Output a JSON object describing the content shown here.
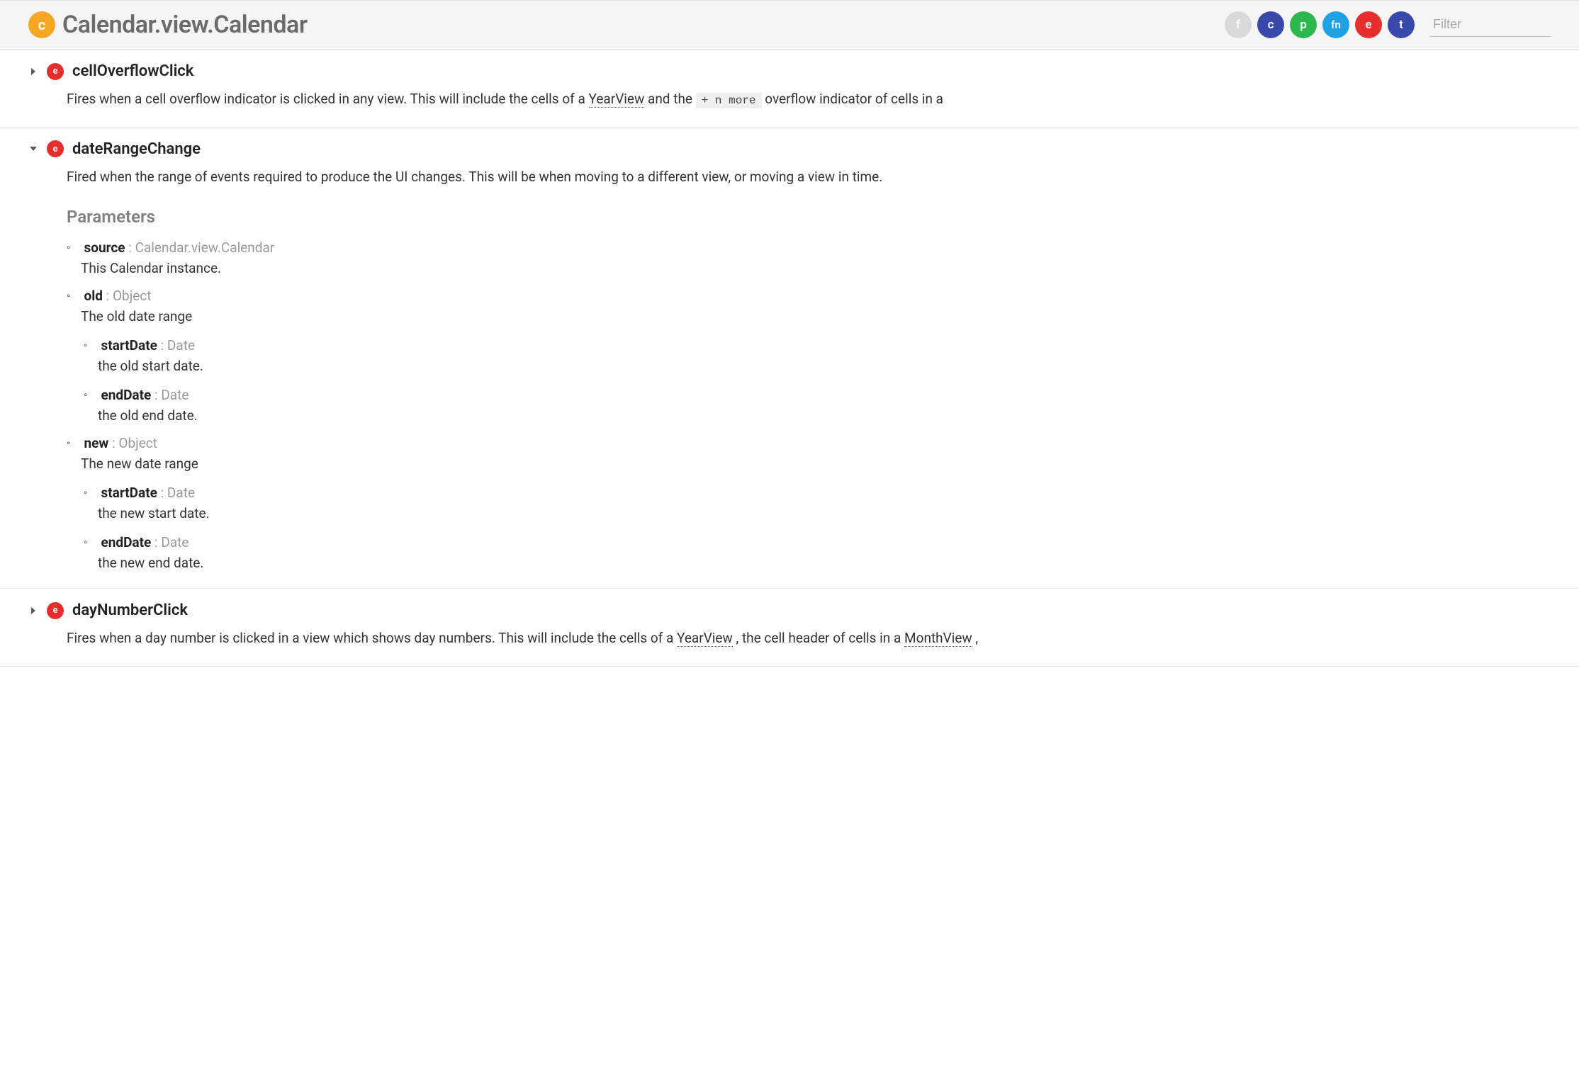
{
  "header": {
    "class_badge": "c",
    "title": "Calendar.view.Calendar",
    "filter_placeholder": "Filter",
    "pills": {
      "f": "f",
      "c": "c",
      "p": "p",
      "fn": "fn",
      "e": "e",
      "t": "t"
    }
  },
  "members": [
    {
      "badge": "e",
      "expanded": false,
      "name": "cellOverflowClick",
      "desc_prefix": "Fires when a cell overflow indicator is clicked in any view. This will include the cells of a ",
      "desc_link1": "YearView",
      "desc_mid": " and the ",
      "desc_code": "+ n more",
      "desc_suffix": " overflow indicator of cells in a"
    },
    {
      "badge": "e",
      "expanded": true,
      "name": "dateRangeChange",
      "desc": "Fired when the range of events required to produce the UI changes. This will be when moving to a different view, or moving a view in time.",
      "parameters_heading": "Parameters",
      "params": [
        {
          "name": "source",
          "type_sep": " : ",
          "type": "Calendar.view.Calendar",
          "desc": "This Calendar instance."
        },
        {
          "name": "old",
          "type_sep": " : ",
          "type": "Object",
          "desc": "The old date range",
          "sub": [
            {
              "name": "startDate",
              "type_sep": " : ",
              "type": "Date",
              "desc": "the old start date."
            },
            {
              "name": "endDate",
              "type_sep": " : ",
              "type": "Date",
              "desc": "the old end date."
            }
          ]
        },
        {
          "name": "new",
          "type_sep": " : ",
          "type": "Object",
          "desc": "The new date range",
          "sub": [
            {
              "name": "startDate",
              "type_sep": " : ",
              "type": "Date",
              "desc": "the new start date."
            },
            {
              "name": "endDate",
              "type_sep": " : ",
              "type": "Date",
              "desc": "the new end date."
            }
          ]
        }
      ]
    },
    {
      "badge": "e",
      "expanded": false,
      "name": "dayNumberClick",
      "desc_prefix": "Fires when a day number is clicked in a view which shows day numbers. This will include the cells of a ",
      "desc_link1": "YearView",
      "desc_mid": ", the cell header of cells in a ",
      "desc_link2": "MonthView",
      "desc_suffix": ","
    }
  ]
}
